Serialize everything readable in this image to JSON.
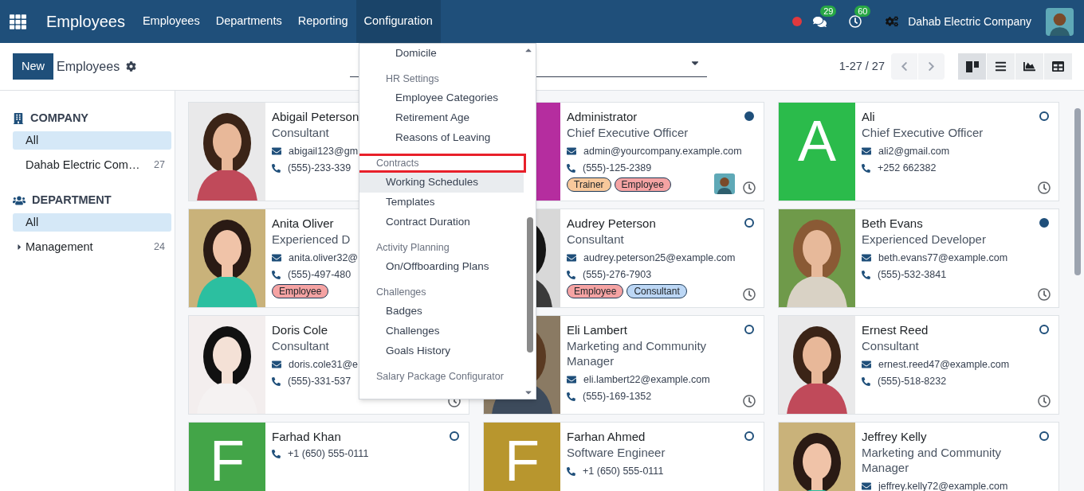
{
  "navbar": {
    "app_title": "Employees",
    "menu": [
      {
        "label": "Employees",
        "selected": false
      },
      {
        "label": "Departments",
        "selected": false
      },
      {
        "label": "Reporting",
        "selected": false
      },
      {
        "label": "Configuration",
        "selected": true
      }
    ],
    "chat_count": "29",
    "activity_count": "60",
    "company": "Dahab Electric Company"
  },
  "control_panel": {
    "new_button": "New",
    "breadcrumb": "Employees",
    "pager": "1-27 / 27",
    "views": [
      {
        "kind": "kanban",
        "selected": true
      },
      {
        "kind": "list",
        "selected": false
      },
      {
        "kind": "graph",
        "selected": false
      },
      {
        "kind": "pivot",
        "selected": false
      }
    ]
  },
  "sidebar": {
    "sections": [
      {
        "kind": "company",
        "title": "COMPANY",
        "items": [
          {
            "label": "All",
            "selected": true
          },
          {
            "label": "Dahab Electric Com…",
            "count": "27",
            "selected": false
          }
        ]
      },
      {
        "kind": "department",
        "title": "DEPARTMENT",
        "items": [
          {
            "label": "All",
            "selected": true
          },
          {
            "label": "Management",
            "count": "24",
            "selected": false,
            "expandable": true
          }
        ]
      }
    ]
  },
  "config_menu": {
    "entries": [
      {
        "kind": "group",
        "children": [
          {
            "kind": "group",
            "children": [
              {
                "kind": "item",
                "label": "Domicile",
                "selected": false
              }
            ]
          },
          {
            "kind": "group",
            "label": "HR Settings",
            "outlined": false,
            "children": [
              {
                "kind": "item",
                "label": "Employee Categories",
                "selected": false
              },
              {
                "kind": "item",
                "label": "Retirement Age",
                "selected": false
              },
              {
                "kind": "item",
                "label": "Reasons of Leaving",
                "selected": false
              }
            ]
          }
        ]
      },
      {
        "kind": "group",
        "label": "Contracts",
        "outlined": true,
        "children": [
          {
            "kind": "item",
            "label": "Working Schedules",
            "selected": true
          },
          {
            "kind": "item",
            "label": "Templates",
            "selected": false
          },
          {
            "kind": "item",
            "label": "Contract Duration",
            "selected": false
          }
        ]
      },
      {
        "kind": "group",
        "label": "Activity Planning",
        "outlined": false,
        "children": [
          {
            "kind": "item",
            "label": "On/Offboarding Plans",
            "selected": false
          }
        ]
      },
      {
        "kind": "group",
        "label": "Challenges",
        "outlined": false,
        "children": [
          {
            "kind": "item",
            "label": "Badges",
            "selected": false
          },
          {
            "kind": "item",
            "label": "Challenges",
            "selected": false
          },
          {
            "kind": "item",
            "label": "Goals History",
            "selected": false
          }
        ]
      },
      {
        "kind": "group",
        "label": "Salary Package Configurator",
        "outlined": false
      }
    ]
  },
  "employees": [
    {
      "name": "Abigail Peterson",
      "job": "Consultant",
      "email": "abigail123@gm",
      "phone": "(555)-233-339",
      "image": {
        "kind": "picture"
      }
    },
    {
      "name": "Administrator",
      "job": "Chief Executive Officer",
      "email": "admin@yourcompany.example.com",
      "phone": "(555)-125-2389",
      "tags": [
        {
          "label": "Trainer",
          "color": "#f8c89b"
        },
        {
          "label": "Employee",
          "color": "#f5a3a3"
        }
      ],
      "present": true,
      "manager_avatar": true,
      "activity": true,
      "image": {
        "kind": "letter",
        "color": "#b52d9f"
      }
    },
    {
      "name": "Ali",
      "job": "Chief Executive Officer",
      "email": "ali2@gmail.com",
      "phone": "+252 662382",
      "present": false,
      "activity": true,
      "image": {
        "kind": "letter",
        "letter": "A",
        "color": "#2bbb4b"
      }
    },
    {
      "name": "Anita Oliver",
      "job": "Experienced D",
      "email": "anita.oliver32@",
      "phone": "(555)-497-480",
      "tags": [
        {
          "label": "Employee",
          "color": "#f5a3a3"
        }
      ],
      "image": {
        "kind": "picture"
      }
    },
    {
      "name": "Audrey Peterson",
      "job": "Consultant",
      "email": "audrey.peterson25@example.com",
      "phone": "(555)-276-7903",
      "tags": [
        {
          "label": "Employee",
          "color": "#f5a3a3"
        },
        {
          "label": "Consultant",
          "color": "#bcd7f5"
        }
      ],
      "present": false,
      "activity": true,
      "image": {
        "kind": "picture"
      }
    },
    {
      "name": "Beth Evans",
      "job": "Experienced Developer",
      "email": "beth.evans77@example.com",
      "phone": "(555)-532-3841",
      "present": true,
      "activity": true,
      "image": {
        "kind": "picture"
      }
    },
    {
      "name": "Doris Cole",
      "job": "Consultant",
      "email": "doris.cole31@e",
      "phone": "(555)-331-537",
      "activity": true,
      "image": {
        "kind": "picture"
      }
    },
    {
      "name": "Eli Lambert",
      "job": "Marketing and Community Manager",
      "email": "eli.lambert22@example.com",
      "phone": "(555)-169-1352",
      "present": false,
      "activity": true,
      "image": {
        "kind": "picture"
      }
    },
    {
      "name": "Ernest Reed",
      "job": "Consultant",
      "email": "ernest.reed47@example.com",
      "phone": "(555)-518-8232",
      "present": false,
      "activity": true,
      "image": {
        "kind": "picture"
      }
    },
    {
      "name": "Farhad Khan",
      "phone": "+1 (650) 555-0111",
      "present": false,
      "image": {
        "kind": "letter",
        "letter": "F",
        "color": "#43a548"
      }
    },
    {
      "name": "Farhan Ahmed",
      "job": "Software Engineer",
      "phone": "+1 (650) 555-0111",
      "present": false,
      "image": {
        "kind": "letter",
        "letter": "F",
        "color": "#b8962e"
      }
    },
    {
      "name": "Jeffrey Kelly",
      "job": "Marketing and Community Manager",
      "email": "jeffrey.kelly72@example.com",
      "present": false,
      "image": {
        "kind": "picture"
      }
    }
  ]
}
